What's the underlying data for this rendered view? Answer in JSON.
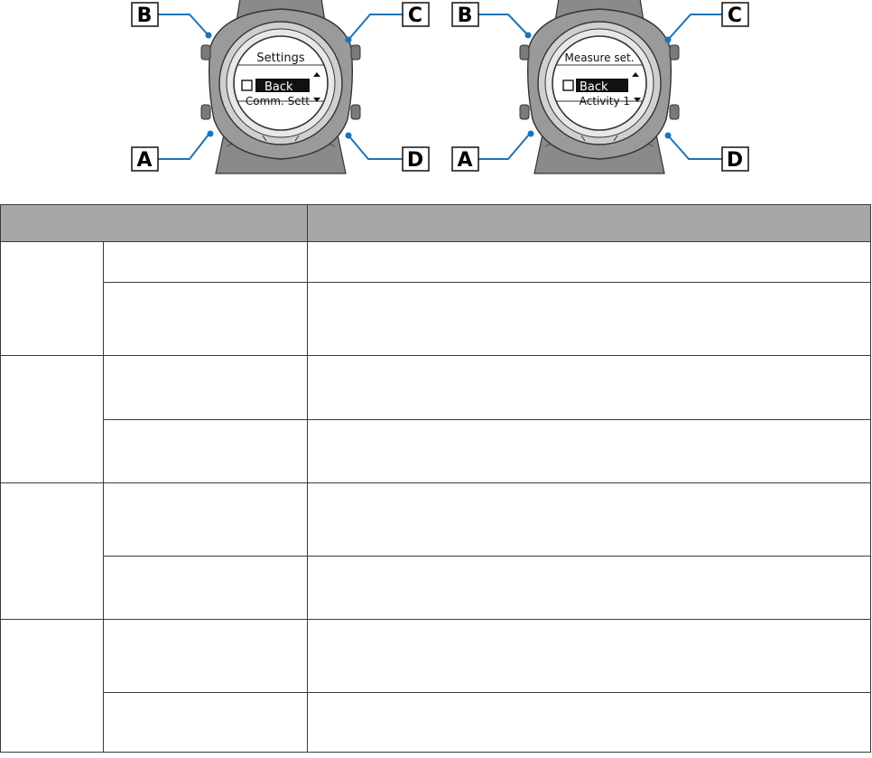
{
  "figure": {
    "watches": [
      {
        "screen_title": "Settings",
        "screen_selected": "Back",
        "screen_next": "Comm. Sett",
        "buttons": {
          "top_left": "B",
          "top_right": "C",
          "bottom_left": "A",
          "bottom_right": "D"
        }
      },
      {
        "screen_title": "Measure set.",
        "screen_selected": "Back",
        "screen_next": "Activity 1",
        "buttons": {
          "top_left": "B",
          "top_right": "C",
          "bottom_left": "A",
          "bottom_right": "D"
        }
      }
    ]
  },
  "table": {
    "header": [
      "",
      ""
    ],
    "rows": [
      [
        "",
        "",
        ""
      ],
      [
        "",
        "",
        ""
      ],
      [
        "",
        "",
        ""
      ],
      [
        "",
        "",
        ""
      ],
      [
        "",
        "",
        ""
      ],
      [
        "",
        "",
        ""
      ],
      [
        "",
        "",
        ""
      ],
      [
        "",
        "",
        ""
      ]
    ]
  }
}
